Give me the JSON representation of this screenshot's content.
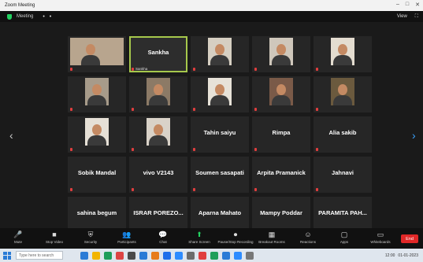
{
  "window": {
    "title": "Zoom Meeting",
    "minimize": "–",
    "maximize": "□",
    "close": "✕"
  },
  "topbar": {
    "meeting_info": "Meeting",
    "dots": "• •",
    "view": "View",
    "more": "⛶"
  },
  "tiles": [
    {
      "name": "",
      "label": "",
      "video": true,
      "wide": true,
      "bg": "#b8a58e"
    },
    {
      "name": "Sankha",
      "label": "Sankha",
      "video": false,
      "active": true
    },
    {
      "name": "",
      "label": "",
      "video": true,
      "bg": "#d6cfc2"
    },
    {
      "name": "",
      "label": "",
      "video": true,
      "bg": "#cfc7bb"
    },
    {
      "name": "",
      "label": "",
      "video": true,
      "bg": "#e4ddd0"
    },
    {
      "name": "",
      "label": "",
      "video": true,
      "bg": "#a79b8a"
    },
    {
      "name": "",
      "label": "",
      "video": true,
      "bg": "#8c7a66"
    },
    {
      "name": "",
      "label": "",
      "video": true,
      "bg": "#e7e2d8"
    },
    {
      "name": "",
      "label": "",
      "video": true,
      "bg": "#7a5a48"
    },
    {
      "name": "",
      "label": "",
      "video": true,
      "bg": "#6b5a3e"
    },
    {
      "name": "",
      "label": "",
      "video": true,
      "bg": "#e6e0d6"
    },
    {
      "name": "",
      "label": "",
      "video": true,
      "bg": "#d9d2c8"
    },
    {
      "name": "Tahin saiyu",
      "label": "",
      "video": false
    },
    {
      "name": "Rimpa",
      "label": "",
      "video": false
    },
    {
      "name": "Alia sakib",
      "label": "",
      "video": false
    },
    {
      "name": "Sobik Mandal",
      "label": "",
      "video": false
    },
    {
      "name": "vivo V2143",
      "label": "",
      "video": false
    },
    {
      "name": "Soumen sasapati",
      "label": "",
      "video": false
    },
    {
      "name": "Arpita Pramanick",
      "label": "",
      "video": false
    },
    {
      "name": "Jahnavi",
      "label": "",
      "video": false
    },
    {
      "name": "sahina begum",
      "label": "",
      "video": false
    },
    {
      "name": "ISRAR POREZO...",
      "label": "",
      "video": false
    },
    {
      "name": "Aparna Mahato",
      "label": "",
      "video": false
    },
    {
      "name": "Mampy Poddar",
      "label": "",
      "video": false
    },
    {
      "name": "PARAMITA PAH...",
      "label": "",
      "video": false
    }
  ],
  "nav": {
    "left_arrow": "‹",
    "right_arrow": "›"
  },
  "toolbar": [
    {
      "icon": "🎤",
      "label": "Mute",
      "icon_name": "mic-icon"
    },
    {
      "icon": "■",
      "label": "Stop Video",
      "icon_name": "video-icon"
    },
    {
      "icon": "⛨",
      "label": "Security",
      "icon_name": "shield-icon"
    },
    {
      "icon": "👥",
      "label": "Participants",
      "icon_name": "participants-icon"
    },
    {
      "icon": "💬",
      "label": "Chat",
      "icon_name": "chat-icon",
      "style": "red"
    },
    {
      "icon": "⬆",
      "label": "Share Screen",
      "icon_name": "share-icon",
      "style": "green"
    },
    {
      "icon": "⏺",
      "label": "Pause/Stop Recording",
      "icon_name": "record-icon"
    },
    {
      "icon": "▦",
      "label": "Breakout Rooms",
      "icon_name": "breakout-icon"
    },
    {
      "icon": "☺",
      "label": "Reactions",
      "icon_name": "reactions-icon"
    },
    {
      "icon": "▢",
      "label": "Apps",
      "icon_name": "apps-icon"
    },
    {
      "icon": "▭",
      "label": "Whiteboards",
      "icon_name": "whiteboard-icon"
    }
  ],
  "end_label": "End",
  "taskbar": {
    "search_placeholder": "Type here to search",
    "time": "12:00",
    "date": "01-01-2023"
  },
  "taskbar_apps": [
    "#2a7bd6",
    "#f2b400",
    "#1f9e5a",
    "#d44",
    "#4a4a4a",
    "#2a7bd6",
    "#e77b1a",
    "#1f6feb",
    "#2d8cff",
    "#6b6b6b",
    "#e03e3e",
    "#1f9e5a",
    "#2a7bd6",
    "#2d8cff",
    "#777"
  ]
}
